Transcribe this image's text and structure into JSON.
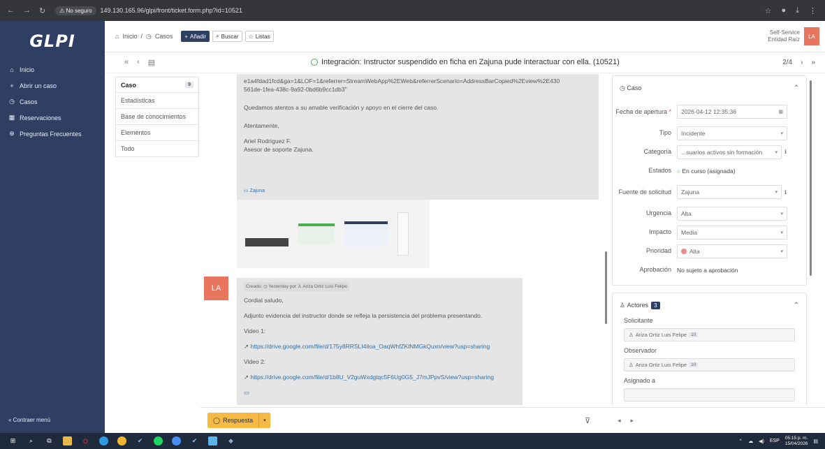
{
  "browser": {
    "warning": "No seguro",
    "url": "149.130.165.96/glpi/front/ticket.form.php?id=10521"
  },
  "app": {
    "logo": "GLPI"
  },
  "sidebar": {
    "items": [
      {
        "icon": "home-icon",
        "glyph": "⌂",
        "label": "Inicio"
      },
      {
        "icon": "plus-icon",
        "glyph": "+",
        "label": "Abrir un caso"
      },
      {
        "icon": "clock-icon",
        "glyph": "◷",
        "label": "Casos"
      },
      {
        "icon": "calendar-icon",
        "glyph": "▦",
        "label": "Reservaciones"
      },
      {
        "icon": "faq-icon",
        "glyph": "⊕",
        "label": "Preguntas Frecuentes"
      }
    ],
    "collapse": "Contraer menú"
  },
  "topbar": {
    "home": "Inicio",
    "separator": "/",
    "section": "Casos",
    "add": "Añadir",
    "search": "Buscar",
    "lists": "Listas",
    "profile": "Self-Service",
    "entity": "Entidad Raíz",
    "initials": "LA"
  },
  "ticket": {
    "title": "Integración: Instructor suspendido en ficha en Zajuna pude interactuar con ella. (10521)",
    "pager": "2/4"
  },
  "tabs": [
    {
      "label": "Caso",
      "badge": "9"
    },
    {
      "label": "Estadísticas"
    },
    {
      "label": "Base de conocimientos"
    },
    {
      "label": "Elementos"
    },
    {
      "label": "Todo"
    }
  ],
  "message1": {
    "line1": "e1a4fdad1fcd&ga=1&LOF=1&referrer=StreamWebApp%2EWeb&referrerScenario=AddressBarCopied%2Eview%2E430",
    "line2": "561de-1fea-438c-9a92-0bd6b9cc1db3\"",
    "p2": "Quedamos atentos a su amable verificación y apoyo en el cierre del caso.",
    "p3": "Atentamente,",
    "sig1": "Ariel Rodríguez F.",
    "sig2": "Asesor de soporte Zajuna.",
    "source": "Zajuna"
  },
  "message2": {
    "avatar": "LA",
    "meta_created": "Creado:",
    "meta_when": "Yesterday por",
    "meta_author": "Ariza Ortiz Luis Felipe",
    "greeting": "Cordial saludo,",
    "body": "Adjunto evidencia del instructor donde se refleja la persistencia del problema presentando.",
    "video1_label": "Video 1:",
    "video1_link": "https://drive.google.com/file/d/175y8RRSLI4iloa_OaqWhfZKlNMGkQuxn/view?usp=sharing",
    "video2_label": "Video 2:",
    "video2_link": "https://drive.google.com/file/d/1b8U_V2guWxdgtqc5F6Ug0G5_J7mJPpvS/view?usp=sharing"
  },
  "panel": {
    "case_header": "Caso",
    "fecha_label": "Fecha de apertura",
    "fecha_value": "2026-04-12 12:35:36",
    "tipo_label": "Tipo",
    "tipo_value": "Incidente",
    "categoria_label": "Categoría",
    "categoria_value": "...suarios activos sin formación",
    "estados_label": "Estados",
    "estados_value": "En curso (asignada)",
    "fuente_label": "Fuente de solicitud",
    "fuente_value": "Zajuna",
    "urgencia_label": "Urgencia",
    "urgencia_value": "Alta",
    "impacto_label": "Impacto",
    "impacto_value": "Media",
    "prioridad_label": "Prioridad",
    "prioridad_value": "Alta",
    "aprobacion_label": "Aprobación",
    "aprobacion_value": "No sujeto a aprobación",
    "actors_header": "Actores",
    "actors_count": "3",
    "solicitante_label": "Solicitante",
    "solicitante_value": "Ariza Ortiz Luis Felipe",
    "solicitante_count": "10",
    "observador_label": "Observador",
    "observador_value": "Ariza Ortiz Luis Felipe",
    "observador_count": "10",
    "asignado_label": "Asignado a"
  },
  "footer": {
    "respuesta": "Respuesta"
  },
  "taskbar": {
    "lang": "ESP",
    "time": "05:15 p. m.",
    "date": "15/04/2026"
  }
}
